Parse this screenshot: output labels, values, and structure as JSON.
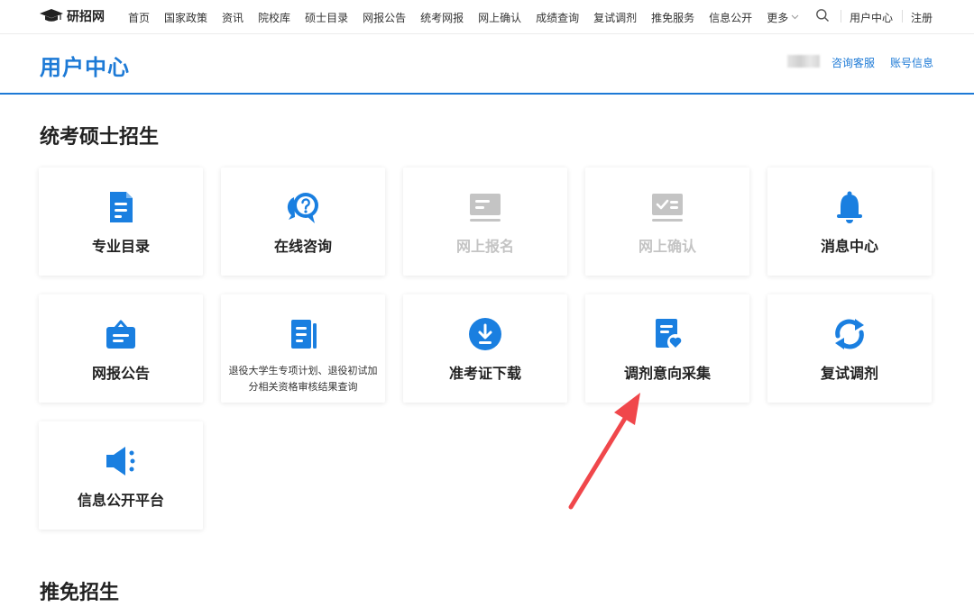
{
  "nav": {
    "logo_text": "研招网",
    "links": [
      "首页",
      "国家政策",
      "资讯",
      "院校库",
      "硕士目录",
      "网报公告",
      "统考网报",
      "网上确认",
      "成绩查询",
      "复试调剂",
      "推免服务",
      "信息公开"
    ],
    "more_label": "更多",
    "user_center": "用户中心",
    "logout": "注册"
  },
  "header": {
    "title": "用户中心",
    "consult_link": "咨询客服",
    "account_link": "账号信息"
  },
  "sections": [
    {
      "title": "统考硕士招生",
      "cards": [
        {
          "label": "专业目录",
          "icon": "document-icon",
          "enabled": true
        },
        {
          "label": "在线咨询",
          "icon": "chat-question-icon",
          "enabled": true
        },
        {
          "label": "网上报名",
          "icon": "monitor-icon",
          "enabled": false
        },
        {
          "label": "网上确认",
          "icon": "monitor-check-icon",
          "enabled": false
        },
        {
          "label": "消息中心",
          "icon": "bell-icon",
          "enabled": true
        },
        {
          "label": "网报公告",
          "icon": "notice-board-icon",
          "enabled": true
        },
        {
          "label": "退役大学生专项计划、退役初试加分相关资格审核结果查询",
          "icon": "report-icon",
          "enabled": true
        },
        {
          "label": "准考证下载",
          "icon": "download-icon",
          "enabled": true
        },
        {
          "label": "调剂意向采集",
          "icon": "file-heart-icon",
          "enabled": true
        },
        {
          "label": "复试调剂",
          "icon": "refresh-icon",
          "enabled": true
        },
        {
          "label": "信息公开平台",
          "icon": "megaphone-icon",
          "enabled": true
        }
      ]
    },
    {
      "title": "推免招生",
      "cards": []
    }
  ],
  "colors": {
    "accent": "#1d7ad6",
    "icon_blue": "#1a7fe0",
    "disabled": "#c4c4c4",
    "annotation_arrow": "#f0474b"
  }
}
